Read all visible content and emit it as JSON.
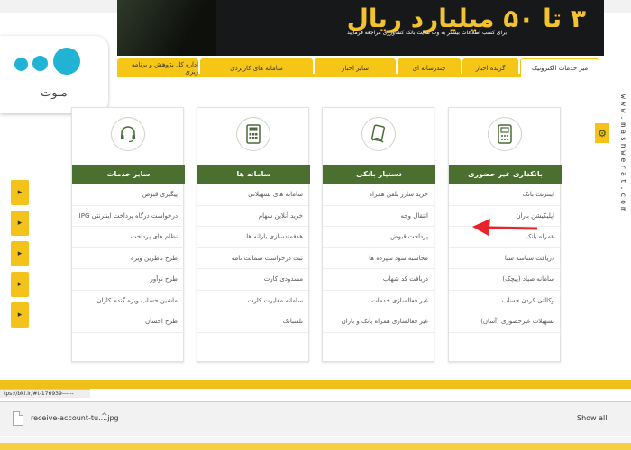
{
  "banner": {
    "headline": "۳ تا ۵۰ میلیارد ریال",
    "note": "برای کسب اطلاعات بیشتر به وب سایت بانک کشاورزی مراجعه فرمایید"
  },
  "nav": {
    "tabs": [
      {
        "label": "میز خدمات الکترونیک",
        "active": true
      },
      {
        "label": "گزیده اخبار"
      },
      {
        "label": "چندرسانه ای"
      },
      {
        "label": "سایر اخبار"
      },
      {
        "label": "سامانه های کاربردی"
      },
      {
        "label": "اداره کل پژوهش و برنامه ریزی"
      }
    ]
  },
  "logo": {
    "text": "مـوت"
  },
  "cards": [
    {
      "title": "بانکداری غیر حضوری",
      "icon": "pos-terminal-icon",
      "items": [
        "اینترنت بانک",
        "اپلیکیشن باران",
        "همراه بانک",
        "دریافت شناسه شبا",
        "سامانه صیاد (پیچک)",
        "وکالتی کردن حساب",
        "تسهیلات غیرحضوری (آسان)"
      ]
    },
    {
      "title": "دستیار بانکی",
      "icon": "card-hand-icon",
      "items": [
        "خرید شارژ تلفن همراه",
        "انتقال وجه",
        "پرداخت قبوض",
        "محاسبه سود سپرده ها",
        "دریافت کد شهاب",
        "غیر فعالسازی خدمات",
        "غیر فعالسازی همراه بانک و باران"
      ]
    },
    {
      "title": "سامانه ها",
      "icon": "calculator-icon",
      "items": [
        "سامانه های تسهیلاتی",
        "خرید آنلاین سهام",
        "هدفمندسازی یارانه ها",
        "ثبت درخواست ضمانت نامه",
        "مسدودی کارت",
        "سامانه مغایرت کارت",
        "تلفنبانک"
      ]
    },
    {
      "title": "سایر خدمات",
      "icon": "headset-icon",
      "items": [
        "پیگیری قبوض",
        "درخواست درگاه پرداخت اینترنتی IPG",
        "نظام های پرداخت",
        "طرح ناظرین ویژه",
        "طرح نوآور",
        "ماشین حساب ویژه گندم کاران",
        "طرح احسان"
      ]
    }
  ],
  "watermark": "www.mashwerat.com",
  "status": {
    "url": "tps://bki.ir/#t-176939------"
  },
  "download": {
    "file_name": "receive-account-tu....jpg",
    "show_all": "Show all"
  },
  "colors": {
    "yellow": "#f6c617",
    "green": "#4b6f2f",
    "arrow": "#e8232a",
    "logo_blue": "#20b3d3"
  }
}
